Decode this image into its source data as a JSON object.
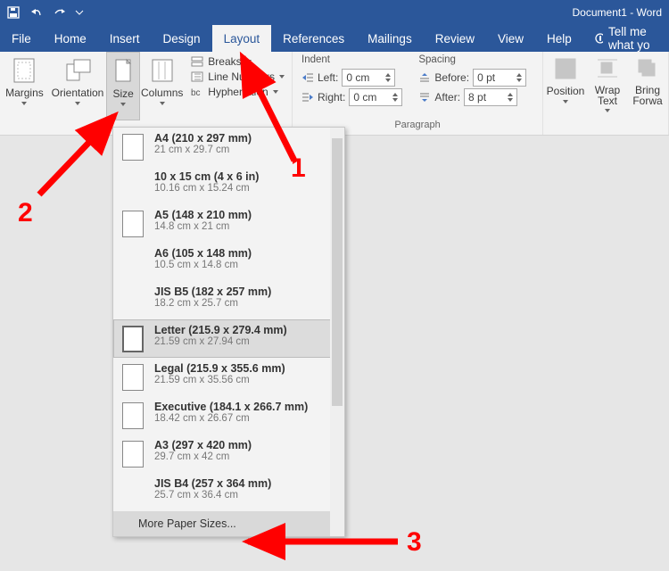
{
  "title": "Document1 - Word",
  "menu": {
    "file": "File",
    "home": "Home",
    "insert": "Insert",
    "design": "Design",
    "layout": "Layout",
    "references": "References",
    "mailings": "Mailings",
    "review": "Review",
    "view": "View",
    "help": "Help",
    "tellme": "Tell me what yo"
  },
  "ribbon": {
    "margins": "Margins",
    "orientation": "Orientation",
    "size": "Size",
    "columns": "Columns",
    "breaks": "Breaks",
    "linenumbers": "Line Numbers",
    "hyphenation": "Hyphenation",
    "indent": "Indent",
    "left": "Left:",
    "right": "Right:",
    "left_v": "0 cm",
    "right_v": "0 cm",
    "spacing": "Spacing",
    "before": "Before:",
    "after": "After:",
    "before_v": "0 pt",
    "after_v": "8 pt",
    "paragraph": "Paragraph",
    "position": "Position",
    "wrap": "Wrap Text",
    "bring": "Bring Forwa"
  },
  "sizes": [
    {
      "t": "A4 (210 x 297 mm)",
      "s": "21 cm x 29.7 cm",
      "icon": true,
      "sel": false
    },
    {
      "t": "10 x 15 cm (4 x 6 in)",
      "s": "10.16 cm x 15.24 cm",
      "icon": false,
      "sel": false
    },
    {
      "t": "A5 (148 x 210 mm)",
      "s": "14.8 cm x 21 cm",
      "icon": true,
      "sel": false
    },
    {
      "t": "A6 (105 x 148 mm)",
      "s": "10.5 cm x 14.8 cm",
      "icon": false,
      "sel": false
    },
    {
      "t": "JIS B5 (182 x 257 mm)",
      "s": "18.2 cm x 25.7 cm",
      "icon": false,
      "sel": false
    },
    {
      "t": "Letter (215.9 x 279.4 mm)",
      "s": "21.59 cm x 27.94 cm",
      "icon": true,
      "sel": true
    },
    {
      "t": "Legal (215.9 x 355.6 mm)",
      "s": "21.59 cm x 35.56 cm",
      "icon": true,
      "sel": false
    },
    {
      "t": "Executive (184.1 x 266.7 mm)",
      "s": "18.42 cm x 26.67 cm",
      "icon": true,
      "sel": false
    },
    {
      "t": "A3 (297 x 420 mm)",
      "s": "29.7 cm x 42 cm",
      "icon": true,
      "sel": false
    },
    {
      "t": "JIS B4 (257 x 364 mm)",
      "s": "25.7 cm x 36.4 cm",
      "icon": false,
      "sel": false
    }
  ],
  "more": "More Paper Sizes...",
  "anno": {
    "n1": "1",
    "n2": "2",
    "n3": "3"
  }
}
